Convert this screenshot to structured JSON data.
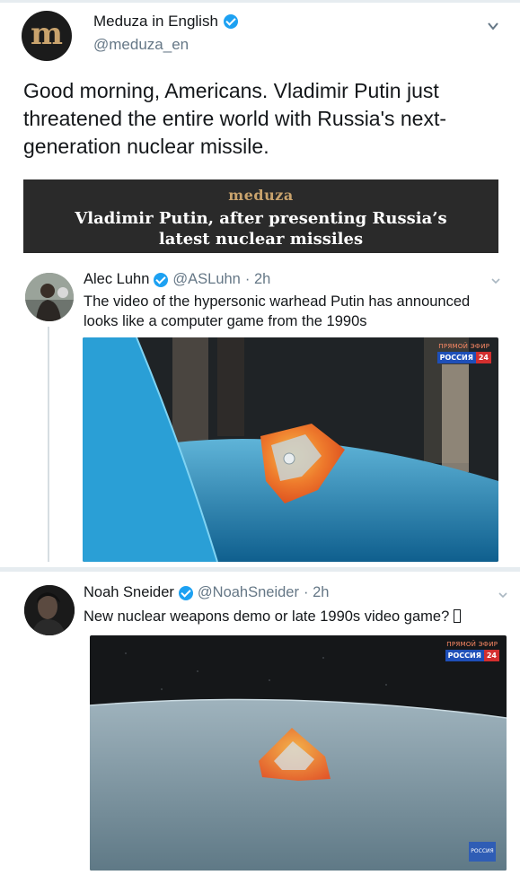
{
  "colors": {
    "accent": "#1da1f2",
    "muted": "#657786",
    "text": "#14171a",
    "meduza_gold": "#c9a36d",
    "card_bg": "#2a2a2a"
  },
  "main_tweet": {
    "avatar_letter": "m",
    "author_name": "Meduza in English",
    "handle": "@meduza_en",
    "text": "Good morning, Americans. Vladimir Putin just threatened the entire world with Russia's next-generation nuclear missile.",
    "menu_icon": "chevron-down-icon"
  },
  "card": {
    "brand": "meduza",
    "title": "Vladimir Putin, after presenting Russia’s latest nuclear missiles"
  },
  "quoted_tweets": [
    {
      "author_name": "Alec Luhn",
      "handle": "@ASLuhn",
      "time": "· 2h",
      "text": "The video of the hypersonic warhead Putin has announced looks like a computer game from the 1990s",
      "media_badge_top": "ПРЯМОЙ ЭФИР",
      "media_badge_channel": "РОССИЯ",
      "media_badge_num": "24"
    },
    {
      "author_name": "Noah Sneider",
      "handle": "@NoahSneider",
      "time": "· 2h",
      "text": "New nuclear weapons demo or late 1990s video game? ",
      "media_badge_top": "ПРЯМОЙ ЭФИР",
      "media_badge_channel": "РОССИЯ",
      "media_badge_num": "24",
      "corner_logo": "РОССИЯ"
    }
  ]
}
